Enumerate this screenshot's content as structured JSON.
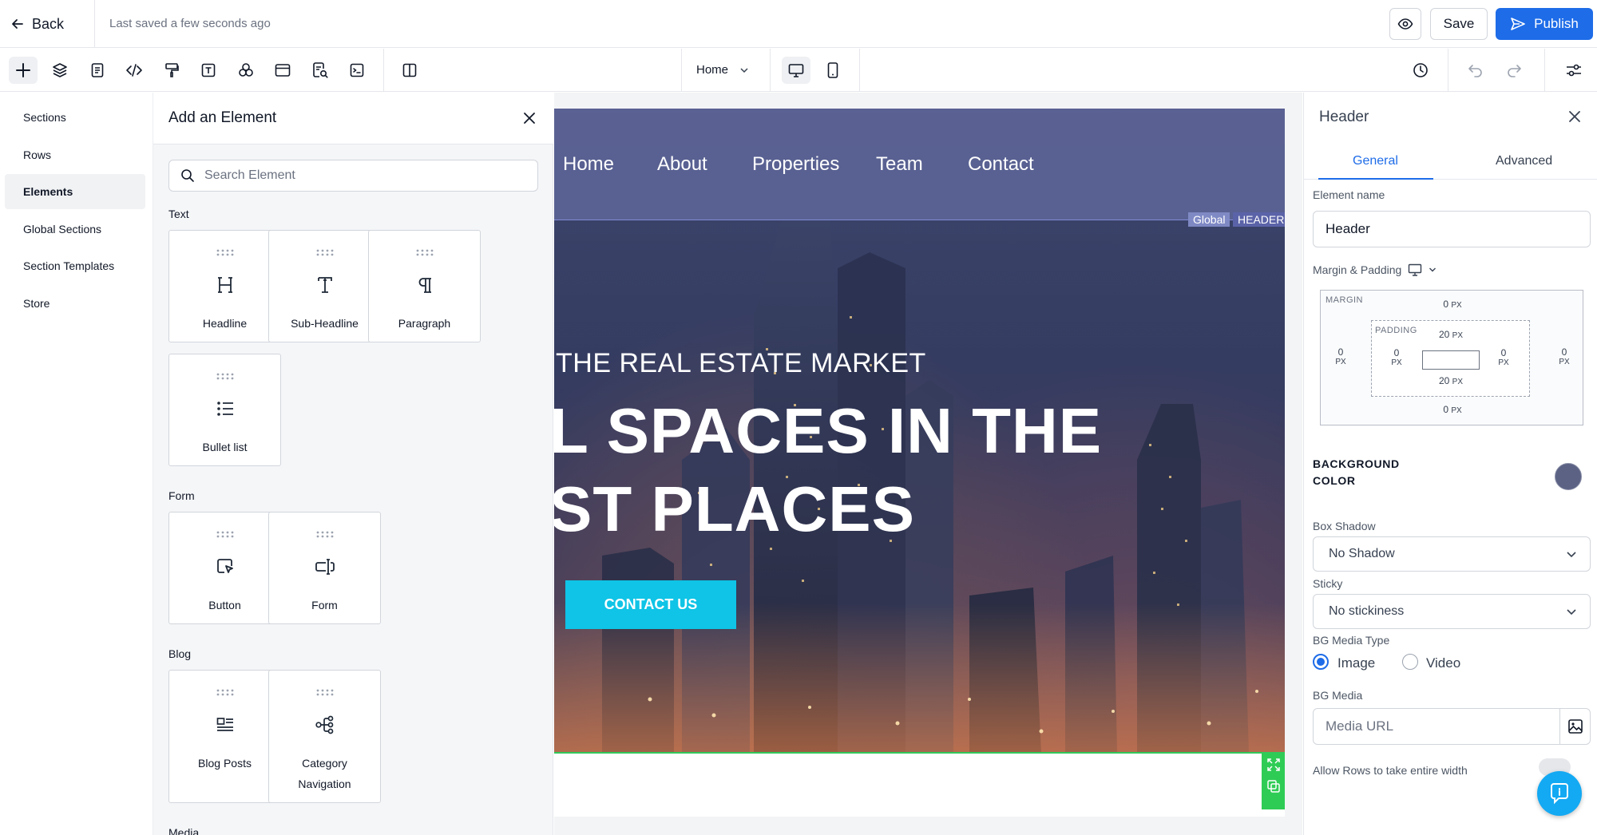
{
  "topbar": {
    "back_label": "Back",
    "saved_status": "Last saved a few seconds ago",
    "save_label": "Save",
    "publish_label": "Publish"
  },
  "toolbar": {
    "page_select_value": "Home"
  },
  "leftnav": {
    "items": [
      {
        "label": "Sections"
      },
      {
        "label": "Rows"
      },
      {
        "label": "Elements"
      },
      {
        "label": "Global Sections"
      },
      {
        "label": "Section Templates"
      },
      {
        "label": "Store"
      }
    ],
    "active": "Elements"
  },
  "add_panel": {
    "title": "Add an Element",
    "search_placeholder": "Search Element",
    "groups": {
      "text": {
        "label": "Text",
        "items": [
          {
            "label": "Headline",
            "icon": "headline-icon"
          },
          {
            "label": "Sub-Headline",
            "icon": "sub-headline-icon"
          },
          {
            "label": "Paragraph",
            "icon": "paragraph-icon"
          },
          {
            "label": "Bullet list",
            "icon": "bullet-list-icon"
          }
        ]
      },
      "form": {
        "label": "Form",
        "items": [
          {
            "label": "Button",
            "icon": "button-icon"
          },
          {
            "label": "Form",
            "icon": "form-icon"
          }
        ]
      },
      "blog": {
        "label": "Blog",
        "items": [
          {
            "label": "Blog Posts",
            "icon": "blog-posts-icon"
          },
          {
            "label": "Category Navigation",
            "line1": "Category",
            "line2": "Navigation",
            "icon": "category-navigation-icon"
          }
        ]
      },
      "media": {
        "label": "Media"
      }
    }
  },
  "canvas": {
    "nav_links": [
      "Home",
      "About",
      "Properties",
      "Team",
      "Contact"
    ],
    "badge_global": "Global",
    "badge_header": "HEADER",
    "hero_subtitle": "THE REAL ESTATE MARKET",
    "hero_title_line1": "L SPACES IN THE",
    "hero_title_line2": "ST PLACES",
    "cta_label": "CONTACT US"
  },
  "right_panel": {
    "title": "Header",
    "tabs": [
      "General",
      "Advanced"
    ],
    "active_tab": "General",
    "element_name_label": "Element name",
    "element_name_value": "Header",
    "margin_padding_label": "Margin & Padding",
    "margin_caption": "MARGIN",
    "padding_caption": "PADDING",
    "margin": {
      "top": "0",
      "right": "0",
      "bottom": "0",
      "left": "0",
      "unit": "PX"
    },
    "padding": {
      "top": "20",
      "right": "0",
      "bottom": "20",
      "left": "0",
      "unit": "PX"
    },
    "background_color_label_line1": "BACKGROUND",
    "background_color_label_line2": "COLOR",
    "background_color": "#5b6284",
    "box_shadow_label": "Box Shadow",
    "box_shadow_value": "No Shadow",
    "sticky_label": "Sticky",
    "sticky_value": "No stickiness",
    "bg_media_type_label": "BG Media Type",
    "bg_media_type_options": [
      "Image",
      "Video"
    ],
    "bg_media_type_selected": "Image",
    "bg_media_label": "BG Media",
    "bg_media_placeholder": "Media URL",
    "full_width_label": "Allow Rows to take entire width"
  },
  "colors": {
    "accent": "#1e6ce8",
    "cta": "#0fc4e6",
    "selection_green": "#2fcc55",
    "header_overlay": "#5c6496"
  }
}
